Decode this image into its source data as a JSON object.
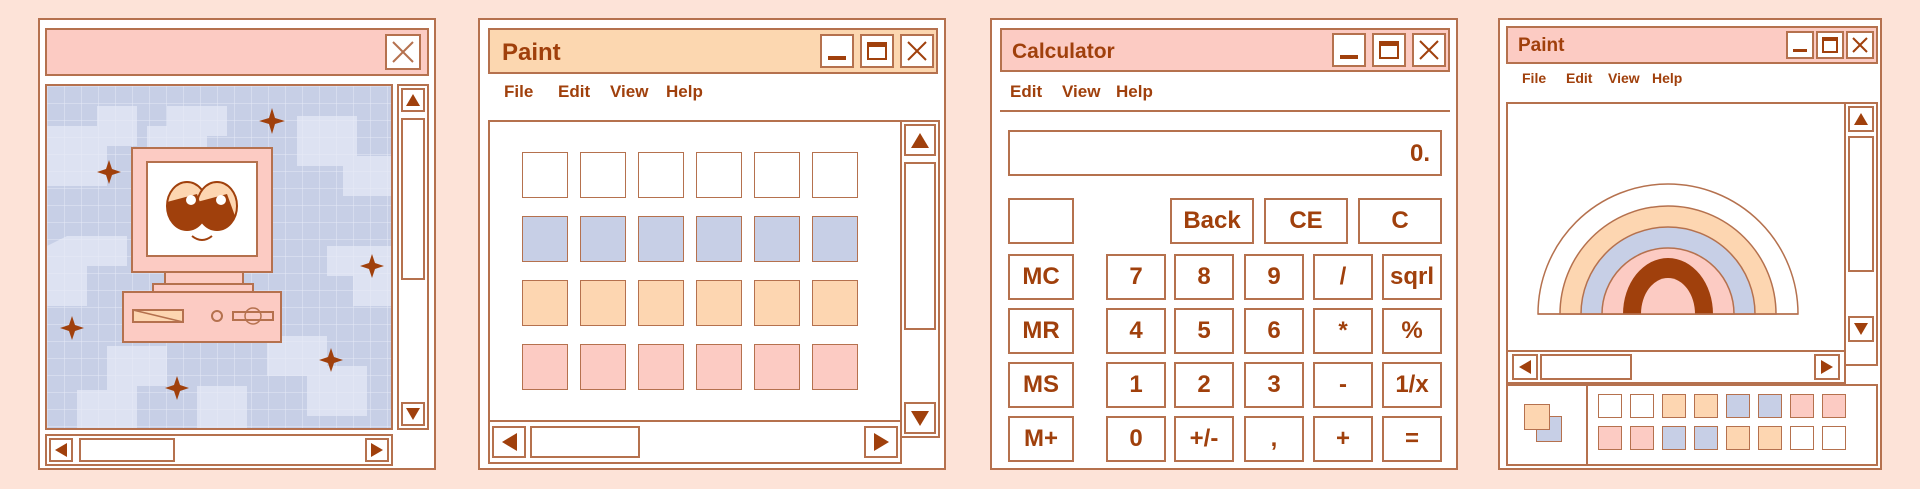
{
  "colors": {
    "background": "#fde3d8",
    "stroke": "#b5714e",
    "text": "#a0400c",
    "peach_titlebar": "#fcd7b0",
    "pink": "#fccbc3",
    "lavender": "#c7cfe6",
    "peach": "#fdd6b1",
    "white": "#ffffff"
  },
  "window1": {
    "title": "",
    "close_icon": "close-icon",
    "illustration": "retro-computer-with-cartoon-eyes",
    "scroll_up_icon": "triangle-up-icon",
    "scroll_down_icon": "triangle-down-icon",
    "scroll_left_icon": "triangle-left-icon",
    "scroll_right_icon": "triangle-right-icon"
  },
  "paint_window": {
    "title": "Paint",
    "menu": [
      "File",
      "Edit",
      "View",
      "Help"
    ],
    "swatch_rows": [
      "white",
      "lavender",
      "peach",
      "pink"
    ],
    "swatches_per_row": 6
  },
  "calculator": {
    "title": "Calculator",
    "menu": [
      "Edit",
      "View",
      "Help"
    ],
    "display": "0.",
    "top_keys": [
      "Back",
      "CE",
      "C"
    ],
    "memory_keys": [
      "MC",
      "MR",
      "MS",
      "M+"
    ],
    "keys": [
      [
        "7",
        "8",
        "9",
        "/",
        "sqrl"
      ],
      [
        "4",
        "5",
        "6",
        "*",
        "%"
      ],
      [
        "1",
        "2",
        "3",
        "-",
        "1/x"
      ],
      [
        "0",
        "+/-",
        ",",
        "+",
        "="
      ]
    ]
  },
  "paint_small": {
    "title": "Paint",
    "menu": [
      "File",
      "Edit",
      "View",
      "Help"
    ],
    "illustration": "rainbow",
    "palette_row1": [
      "white",
      "white",
      "peach",
      "peach",
      "lavender",
      "lavender",
      "pink",
      "pink"
    ],
    "palette_row2": [
      "pink",
      "pink",
      "lavender",
      "lavender",
      "peach",
      "peach",
      "white",
      "white"
    ]
  }
}
